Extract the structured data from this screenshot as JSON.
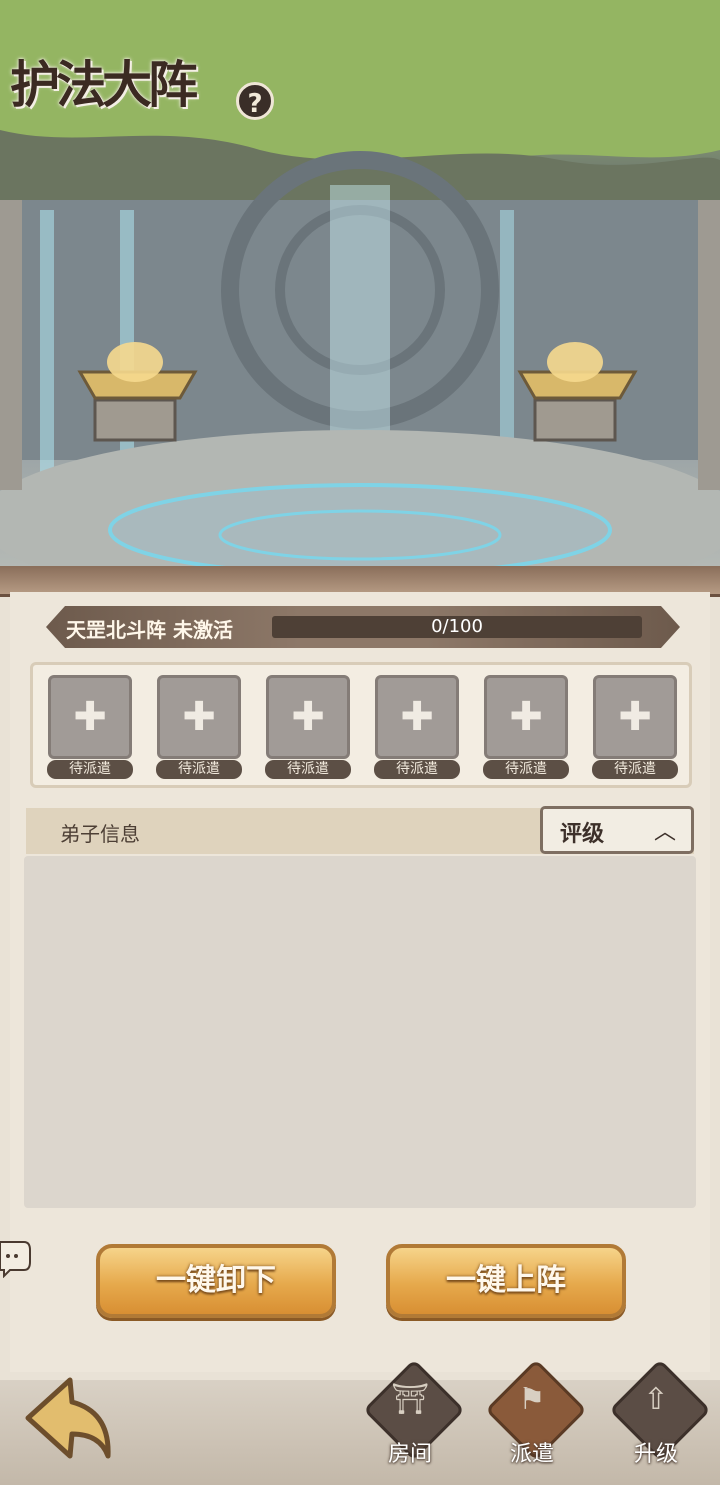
{
  "header": {
    "title": "护法大阵",
    "help_icon": "?"
  },
  "formation": {
    "name_status": "天罡北斗阵 未激活",
    "progress_text": "0/100",
    "progress_value": 0,
    "progress_max": 100
  },
  "slots": [
    {
      "label": "待派遣"
    },
    {
      "label": "待派遣"
    },
    {
      "label": "待派遣"
    },
    {
      "label": "待派遣"
    },
    {
      "label": "待派遣"
    },
    {
      "label": "待派遣"
    }
  ],
  "info": {
    "title": "弟子信息",
    "sort_label": "评级"
  },
  "actions": {
    "unload_all": "一键卸下",
    "deploy_all": "一键上阵"
  },
  "nav": [
    {
      "label": "房间",
      "icon": "gate-icon"
    },
    {
      "label": "派遣",
      "icon": "flag-icon"
    },
    {
      "label": "升级",
      "icon": "upgrade-icon"
    }
  ],
  "colors": {
    "button": "#e6a94c",
    "panel": "#ede6da",
    "banner": "#8d7868"
  }
}
